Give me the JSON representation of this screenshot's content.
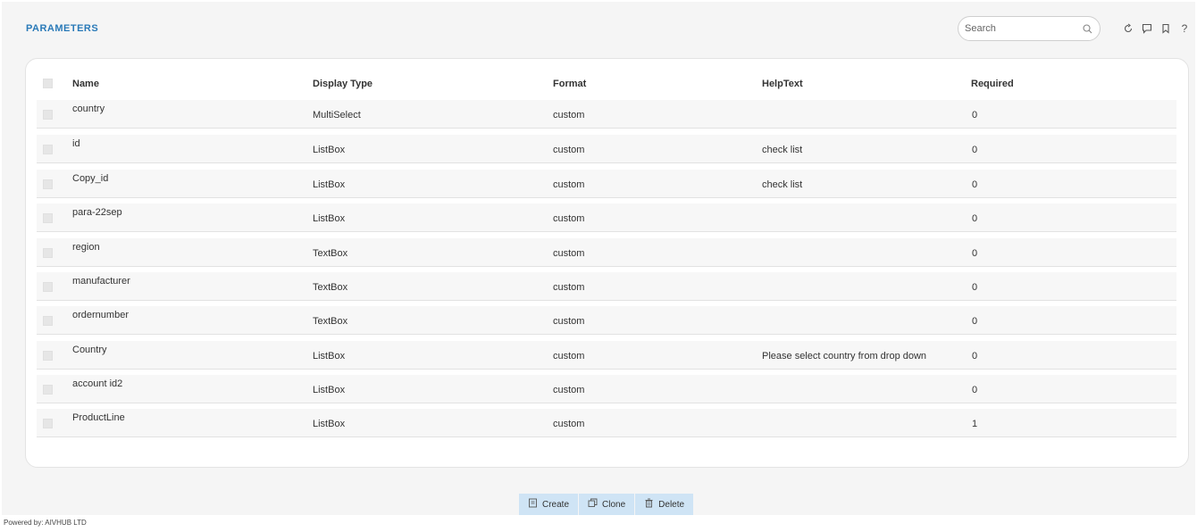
{
  "header": {
    "title": "PARAMETERS"
  },
  "search": {
    "placeholder": "Search"
  },
  "table": {
    "columns": [
      "Name",
      "Display Type",
      "Format",
      "HelpText",
      "Required"
    ],
    "rows": [
      {
        "name": "country",
        "display_type": "MultiSelect",
        "format": "custom",
        "helptext": "",
        "required": "0"
      },
      {
        "name": "id",
        "display_type": "ListBox",
        "format": "custom",
        "helptext": "check list",
        "required": "0"
      },
      {
        "name": "Copy_id",
        "display_type": "ListBox",
        "format": "custom",
        "helptext": "check list",
        "required": "0"
      },
      {
        "name": "para-22sep",
        "display_type": "ListBox",
        "format": "custom",
        "helptext": "",
        "required": "0"
      },
      {
        "name": "region",
        "display_type": "TextBox",
        "format": "custom",
        "helptext": "",
        "required": "0"
      },
      {
        "name": "manufacturer",
        "display_type": "TextBox",
        "format": "custom",
        "helptext": "",
        "required": "0"
      },
      {
        "name": "ordernumber",
        "display_type": "TextBox",
        "format": "custom",
        "helptext": "",
        "required": "0"
      },
      {
        "name": "Country",
        "display_type": "ListBox",
        "format": "custom",
        "helptext": "Please select country from drop down",
        "required": "0"
      },
      {
        "name": "account id2",
        "display_type": "ListBox",
        "format": "custom",
        "helptext": "",
        "required": "0"
      },
      {
        "name": "ProductLine",
        "display_type": "ListBox",
        "format": "custom",
        "helptext": "",
        "required": "1"
      }
    ]
  },
  "actions": {
    "create": "Create",
    "clone": "Clone",
    "delete": "Delete"
  },
  "footer": {
    "text": "Powered by: AIVHUB LTD"
  },
  "colors": {
    "accent": "#2a7ab8",
    "button_bg": "#cfe4f5"
  }
}
